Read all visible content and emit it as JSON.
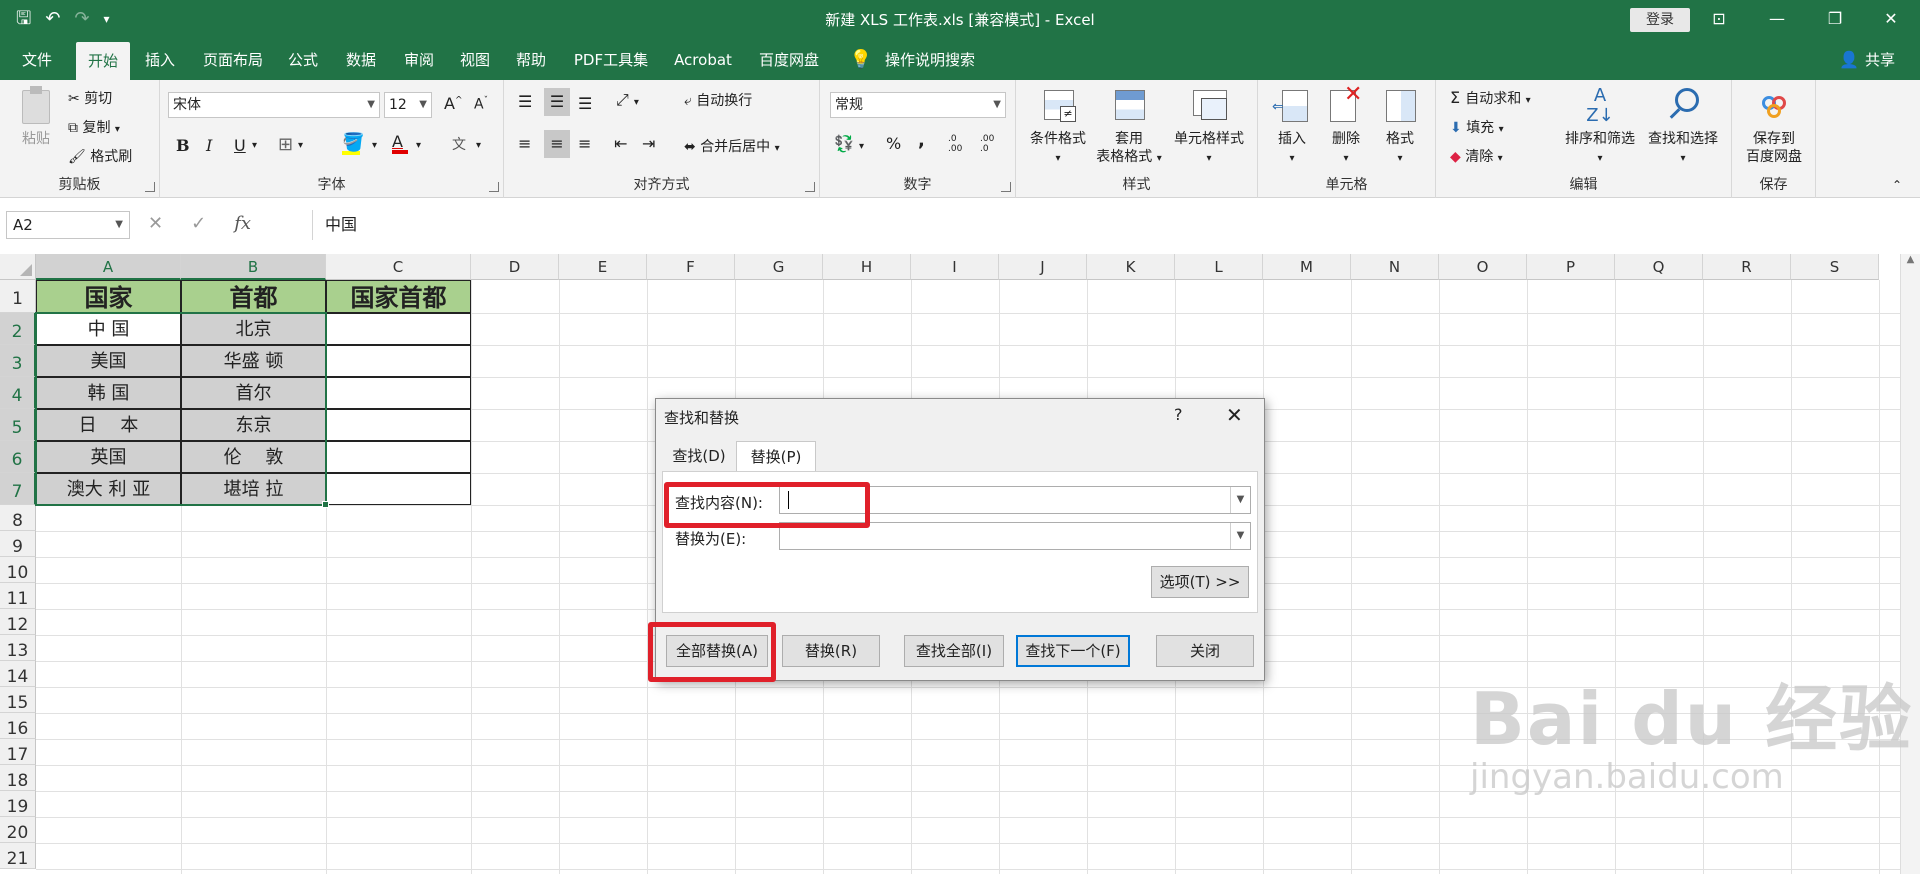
{
  "titlebar": {
    "title": "新建 XLS 工作表.xls  [兼容模式]  -  Excel",
    "login_label": "登录",
    "minimize": "—",
    "restore": "❐",
    "close": "✕",
    "ribbon_display": "⊡"
  },
  "menu": {
    "tabs": [
      "文件",
      "开始",
      "插入",
      "页面布局",
      "公式",
      "数据",
      "审阅",
      "视图",
      "帮助",
      "PDF工具集",
      "Acrobat",
      "百度网盘"
    ],
    "active_tab": "开始",
    "tell_me": "操作说明搜索",
    "share": "共享"
  },
  "ribbon": {
    "clipboard": {
      "label": "剪贴板",
      "paste": "粘贴",
      "cut": "剪切",
      "copy": "复制",
      "format_painter": "格式刷"
    },
    "font": {
      "label": "字体",
      "font_name": "宋体",
      "font_size": "12",
      "bold": "B",
      "italic": "I",
      "underline": "U",
      "grow": "A",
      "shrink": "A"
    },
    "alignment": {
      "label": "对齐方式",
      "wrap": "自动换行",
      "merge": "合并后居中"
    },
    "number": {
      "label": "数字",
      "format": "常规",
      "percent": "%",
      "comma": ",",
      "inc_decimal": ".0 .00",
      "dec_decimal": ".00 .0"
    },
    "styles": {
      "label": "样式",
      "conditional": "条件格式",
      "table_format_1": "套用",
      "table_format_2": "表格格式",
      "cell_styles": "单元格样式"
    },
    "cells": {
      "label": "单元格",
      "insert": "插入",
      "delete": "删除",
      "format": "格式"
    },
    "editing": {
      "label": "编辑",
      "autosum": "自动求和",
      "fill": "填充",
      "clear": "清除",
      "sort_filter": "排序和筛选",
      "find_select": "查找和选择"
    },
    "save": {
      "label": "保存",
      "save_to_1": "保存到",
      "save_to_2": "百度网盘"
    }
  },
  "formula_bar": {
    "name_box": "A2",
    "formula": "中国",
    "fx": "fx"
  },
  "grid": {
    "columns": [
      "A",
      "B",
      "C",
      "D",
      "E",
      "F",
      "G",
      "H",
      "I",
      "J",
      "K",
      "L",
      "M",
      "N",
      "O",
      "P",
      "Q",
      "R",
      "S"
    ],
    "rows": [
      "1",
      "2",
      "3",
      "4",
      "5",
      "6",
      "7",
      "8",
      "9",
      "10",
      "11",
      "12",
      "13",
      "14",
      "15",
      "16",
      "17",
      "18",
      "19",
      "20",
      "21"
    ],
    "header_row": [
      "国家",
      "首都",
      "国家首都"
    ],
    "data": [
      [
        "中 国",
        "北京"
      ],
      [
        "美国",
        "华盛 顿"
      ],
      [
        "韩 国",
        "首尔"
      ],
      [
        "日　 本",
        "东京"
      ],
      [
        "英国",
        "伦　 敦"
      ],
      [
        "澳大 利 亚",
        "堪培 拉"
      ]
    ],
    "header_fill": "#a9d08e",
    "selection_fill": "#d0d0d0"
  },
  "dialog": {
    "title": "查找和替换",
    "help": "?",
    "close": "✕",
    "tabs": [
      "查找(D)",
      "替换(P)"
    ],
    "active_tab": "替换(P)",
    "find_label": "查找内容(N):",
    "find_value": "",
    "replace_label": "替换为(E):",
    "replace_value": "",
    "options_button": "选项(T) >>",
    "buttons": [
      "全部替换(A)",
      "替换(R)",
      "查找全部(I)",
      "查找下一个(F)",
      "关闭"
    ],
    "highlight_color": "#e0202a"
  },
  "watermark": {
    "brand": "Bai du 经验",
    "url": "jingyan.baidu.com"
  }
}
